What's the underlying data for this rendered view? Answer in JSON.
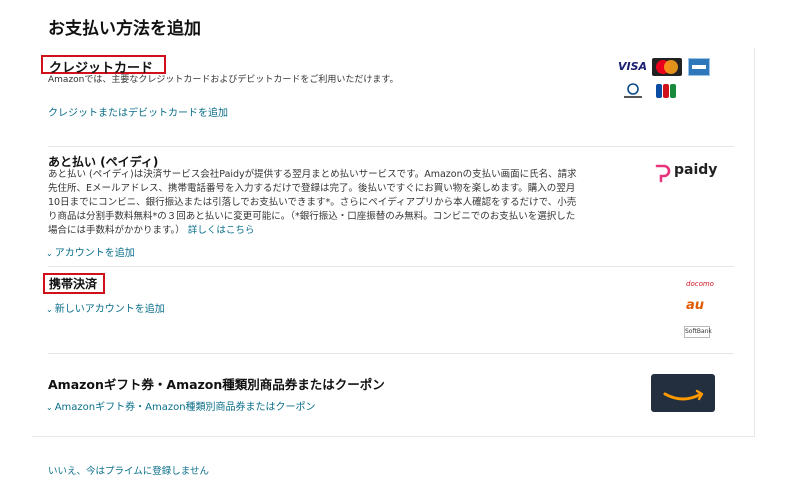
{
  "page": {
    "title": "お支払い方法を追加"
  },
  "credit_card": {
    "title": "クレジットカード",
    "description": "Amazonでは、主要なクレジットカードおよびデビットカードをご利用いただけます。",
    "add_link": "クレジットまたはデビットカードを追加",
    "logos": {
      "visa": "VISA",
      "mastercard": "MasterCard",
      "amex": "AMEX",
      "jcb": "JCB",
      "diners": "Diners Club International"
    }
  },
  "paidy": {
    "title": "あと払い (ペイディ)",
    "description_lines": [
      "あと払い (ペイディ)は決済サービス会社Paidyが提供する翌月まとめ払いサービスです。Amazonの支払い画面に氏名、請求",
      "先住所、Eメールアドレス、携帯電話番号を入力するだけで登録は完了。後払いですぐにお買い物を楽しめます。購入の翌月",
      "10日までにコンビニ、銀行振込または引落しでお支払いできます*。さらにペイディアプリから本人確認をするだけで、小売",
      "り商品は分割手数料無料*の３回あと払いに変更可能に。（*銀行振込・口座振替のみ無料。コンビニでのお支払いを選択した",
      "場合には手数料がかかります。）"
    ],
    "details_link": "詳しくはこちら",
    "add_link": "アカウントを追加",
    "logo_text": "paidy"
  },
  "carrier": {
    "title": "携帯決済",
    "add_link": "新しいアカウントを追加",
    "logos": {
      "docomo": "docomo",
      "au": "au",
      "softbank": "SoftBank"
    }
  },
  "gift": {
    "title": "Amazonギフト券・Amazon種類別商品券またはクーポン",
    "add_link": "Amazonギフト券・Amazon種類別商品券またはクーポン"
  },
  "footer": {
    "decline_link": "いいえ、今はプライムに登録しません"
  },
  "colors": {
    "link": "#0a6e8a",
    "highlight_box": "#d0101a",
    "amazon_dark": "#232f3e",
    "amazon_orange": "#ff9900"
  }
}
